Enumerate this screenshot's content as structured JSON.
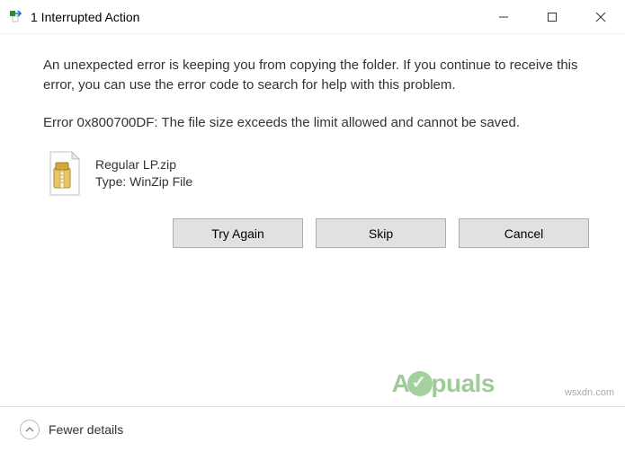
{
  "titlebar": {
    "title": "1 Interrupted Action"
  },
  "messages": {
    "paragraph1": "An unexpected error is keeping you from copying the folder. If you continue to receive this error, you can use the error code to search for help with this problem.",
    "paragraph2": "Error 0x800700DF: The file size exceeds the limit allowed and cannot be saved."
  },
  "file": {
    "name": "Regular LP.zip",
    "type_label": "Type: WinZip File"
  },
  "buttons": {
    "try_again": "Try Again",
    "skip": "Skip",
    "cancel": "Cancel"
  },
  "footer": {
    "fewer_details": "Fewer details"
  },
  "watermark": {
    "brand_left": "A",
    "brand_right": "puals",
    "site": "wsxdn.com"
  }
}
